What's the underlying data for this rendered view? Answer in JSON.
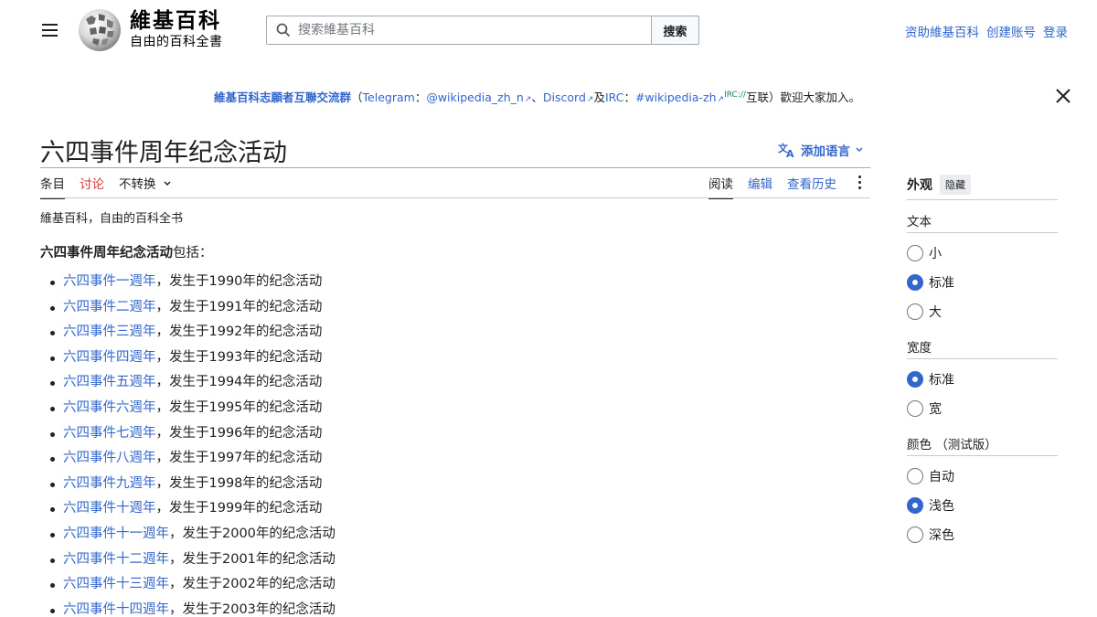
{
  "header": {
    "logo_name": "維基百科",
    "logo_tagline": "自由的百科全書",
    "search_placeholder": "搜索維基百科",
    "search_button": "搜索",
    "user_links": [
      "资助維基百科",
      "创建账号",
      "登录"
    ]
  },
  "notice": {
    "group_link": "維基百科志願者互聯交流群",
    "open_paren": "（",
    "telegram_label": "Telegram",
    "colon1": "：",
    "telegram_handle": "@wikipedia_zh_n",
    "sep1": "、",
    "discord": "Discord",
    "and": "及",
    "irc_label": "IRC",
    "colon2": "：",
    "irc_channel": "#wikipedia-zh",
    "irc_sup": "IRC://",
    "tail": "互联）歡迎大家加入。"
  },
  "page": {
    "title": "六四事件周年纪念活动",
    "add_languages": "添加语言",
    "tabs_left": [
      "条目",
      "讨论",
      "不转换"
    ],
    "tabs_right": [
      "阅读",
      "编辑",
      "查看历史"
    ],
    "site_sub": "維基百科，自由的百科全书",
    "intro_bold": "六四事件周年纪念活动",
    "intro_rest": "包括："
  },
  "list": [
    {
      "link": "六四事件一週年",
      "text": "，发生于1990年的纪念活动"
    },
    {
      "link": "六四事件二週年",
      "text": "，发生于1991年的纪念活动"
    },
    {
      "link": "六四事件三週年",
      "text": "，发生于1992年的纪念活动"
    },
    {
      "link": "六四事件四週年",
      "text": "，发生于1993年的纪念活动"
    },
    {
      "link": "六四事件五週年",
      "text": "，发生于1994年的纪念活动"
    },
    {
      "link": "六四事件六週年",
      "text": "，发生于1995年的纪念活动"
    },
    {
      "link": "六四事件七週年",
      "text": "，发生于1996年的纪念活动"
    },
    {
      "link": "六四事件八週年",
      "text": "，发生于1997年的纪念活动"
    },
    {
      "link": "六四事件九週年",
      "text": "，发生于1998年的纪念活动"
    },
    {
      "link": "六四事件十週年",
      "text": "，发生于1999年的纪念活动"
    },
    {
      "link": "六四事件十一週年",
      "text": "，发生于2000年的纪念活动"
    },
    {
      "link": "六四事件十二週年",
      "text": "，发生于2001年的纪念活动"
    },
    {
      "link": "六四事件十三週年",
      "text": "，发生于2002年的纪念活动"
    },
    {
      "link": "六四事件十四週年",
      "text": "，发生于2003年的纪念活动"
    }
  ],
  "appearance": {
    "title": "外观",
    "hide": "隐藏",
    "text_label": "文本",
    "text_options": [
      "小",
      "标准",
      "大"
    ],
    "text_selected": 1,
    "width_label": "宽度",
    "width_options": [
      "标准",
      "宽"
    ],
    "width_selected": 0,
    "color_label": "颜色 （测试版）",
    "color_options": [
      "自动",
      "浅色",
      "深色"
    ],
    "color_selected": 1
  },
  "colors": {
    "link": "#3366cc",
    "talk_tab": "#d73333",
    "radio_checked": "#3366cc"
  }
}
